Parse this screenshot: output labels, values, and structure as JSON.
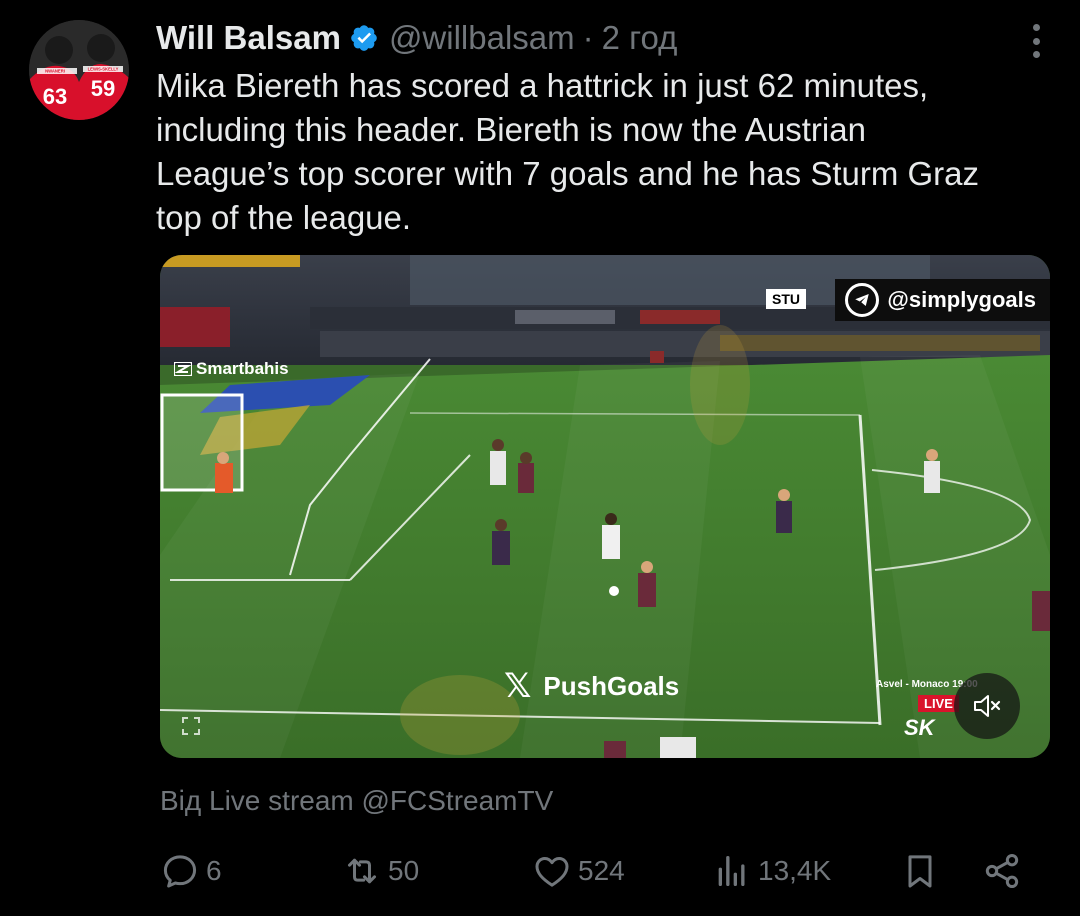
{
  "author": {
    "name": "Will Balsam",
    "handle": "@willbalsam",
    "separator": "·",
    "time": "2 год",
    "verified": true,
    "avatar_numbers": [
      "63",
      "59"
    ],
    "avatar_names": [
      "NWANERI",
      "LEWIS-SKELLY"
    ]
  },
  "tweet": {
    "text": "Mika Biereth has scored a hattrick in just 62 minutes,\nincluding this header. Biereth is now the Austrian\nLeague’s top scorer with 7 goals and he has Sturm Graz\ntop of the league."
  },
  "media": {
    "watermark_top": "@simplygoals",
    "scoreboard_team": "STU",
    "sponsor_left": "Smartbahis",
    "watermark_center": "PushGoals",
    "match_info": "Asvel - Monaco 19:00",
    "live_label": "LIVE",
    "channel": "SK",
    "muted": true
  },
  "source": {
    "text": "Від Live stream @FCStreamTV"
  },
  "actions": {
    "replies": "6",
    "reposts": "50",
    "likes": "524",
    "views": "13,4K"
  },
  "colors": {
    "background": "#000000",
    "text_primary": "#e7e9ea",
    "text_secondary": "#71767b",
    "verified_blue": "#1d9bf0",
    "pitch_green": "#3f7a2e",
    "live_red": "#d9142b"
  },
  "icons": {
    "more": "more-vertical-icon",
    "verified": "verified-badge-icon",
    "reply": "reply-icon",
    "repost": "repost-icon",
    "like": "heart-icon",
    "views": "views-chart-icon",
    "bookmark": "bookmark-icon",
    "share": "share-icon",
    "mute": "muted-speaker-icon",
    "expand": "expand-icon"
  }
}
